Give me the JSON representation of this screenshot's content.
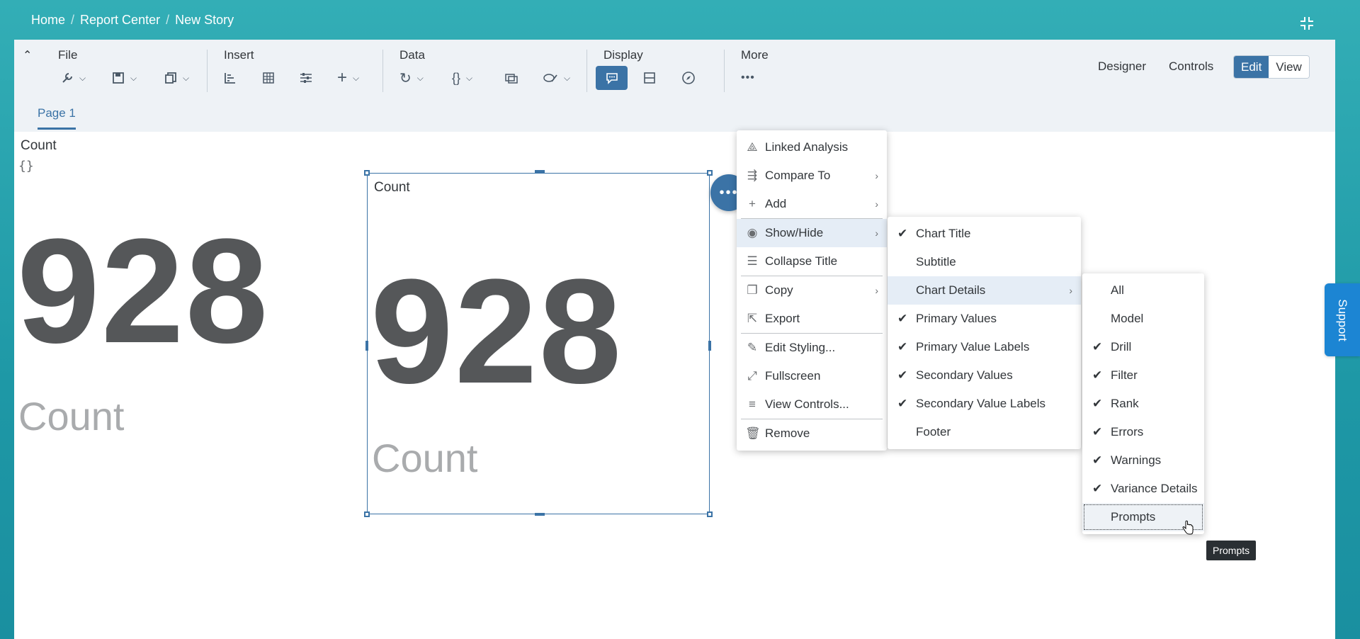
{
  "breadcrumbs": [
    "Home",
    "Report Center",
    "New Story"
  ],
  "toolbar": {
    "groups": {
      "file": "File",
      "insert": "Insert",
      "data": "Data",
      "display": "Display",
      "more": "More"
    },
    "right_links": {
      "designer": "Designer",
      "controls": "Controls"
    },
    "mode": {
      "edit": "Edit",
      "view": "View",
      "active": "Edit"
    }
  },
  "pages": {
    "tab1": "Page 1"
  },
  "tiles": [
    {
      "title": "Count",
      "subtitle": "{}",
      "value": "928",
      "label": "Count"
    },
    {
      "title": "Count",
      "value": "928",
      "label": "Count"
    }
  ],
  "context_menu": {
    "items": [
      {
        "label": "Linked Analysis",
        "icon": "linked-analysis-icon"
      },
      {
        "label": "Compare To",
        "icon": "compare-icon",
        "submenu": true
      },
      {
        "label": "Add",
        "icon": "plus-icon",
        "submenu": true
      },
      {
        "label": "Show/Hide",
        "icon": "eye-icon",
        "submenu": true
      },
      {
        "label": "Collapse Title",
        "icon": "collapse-title-icon"
      },
      {
        "label": "Copy",
        "icon": "copy-icon",
        "submenu": true
      },
      {
        "label": "Export",
        "icon": "export-icon"
      },
      {
        "label": "Edit Styling...",
        "icon": "brush-icon"
      },
      {
        "label": "Fullscreen",
        "icon": "fullscreen-icon"
      },
      {
        "label": "View Controls...",
        "icon": "controls-icon"
      },
      {
        "label": "Remove",
        "icon": "trash-icon"
      }
    ]
  },
  "showhide_menu": {
    "items": [
      {
        "label": "Chart Title",
        "checked": true
      },
      {
        "label": "Subtitle",
        "checked": false
      },
      {
        "label": "Chart Details",
        "checked": false,
        "submenu": true
      },
      {
        "label": "Primary Values",
        "checked": true
      },
      {
        "label": "Primary Value Labels",
        "checked": true
      },
      {
        "label": "Secondary Values",
        "checked": true
      },
      {
        "label": "Secondary Value Labels",
        "checked": true
      },
      {
        "label": "Footer",
        "checked": false
      }
    ]
  },
  "details_menu": {
    "items": [
      {
        "label": "All",
        "checked": false
      },
      {
        "label": "Model",
        "checked": false
      },
      {
        "label": "Drill",
        "checked": true
      },
      {
        "label": "Filter",
        "checked": true
      },
      {
        "label": "Rank",
        "checked": true
      },
      {
        "label": "Errors",
        "checked": true
      },
      {
        "label": "Warnings",
        "checked": true
      },
      {
        "label": "Variance Details",
        "checked": true
      },
      {
        "label": "Prompts",
        "checked": false
      }
    ]
  },
  "tooltip": "Prompts",
  "support": "Support",
  "colors": {
    "accent": "#3b73a6",
    "header": "#2ba3ab",
    "support": "#1c85d3"
  }
}
